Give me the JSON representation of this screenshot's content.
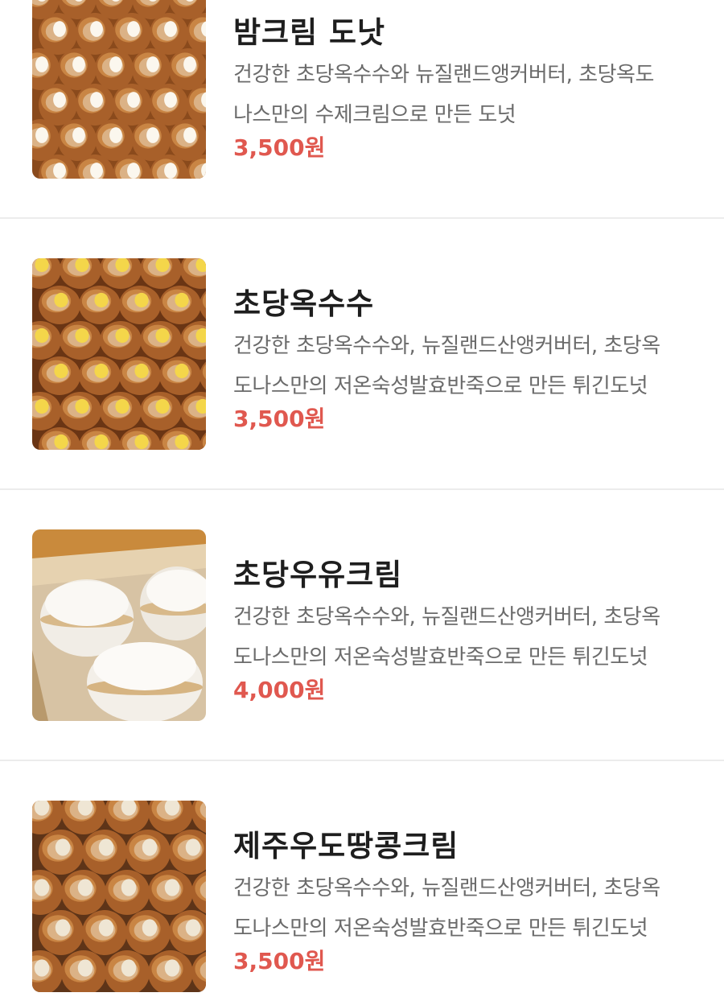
{
  "menu": {
    "items": [
      {
        "name": "밤크림 도낫",
        "description_lines": [
          "건강한 초당옥수수와 뉴질랜드앵커버터, 초당옥도",
          "나스만의 수제크림으로 만든 도넛"
        ],
        "price": "3,500원",
        "image_icon": "cream-donut-photo"
      },
      {
        "name": "초당옥수수",
        "description_lines": [
          "건강한 초당옥수수와, 뉴질랜드산앵커버터, 초당옥",
          "도나스만의 저온숙성발효반죽으로 만든 튀긴도넛"
        ],
        "price": "3,500원",
        "image_icon": "corn-cream-donut-photo"
      },
      {
        "name": "초당우유크림",
        "description_lines": [
          "건강한 초당옥수수와, 뉴질랜드산앵커버터, 초당옥",
          "도나스만의 저온숙성발효반죽으로 만든 튀긴도넛"
        ],
        "price": "4,000원",
        "image_icon": "milk-cream-donut-photo"
      },
      {
        "name": "제주우도땅콩크림",
        "description_lines": [
          "건강한 초당옥수수와, 뉴질랜드산앵커버터, 초당옥",
          "도나스만의 저온숙성발효반죽으로 만든 튀긴도넛"
        ],
        "price": "3,500원",
        "image_icon": "peanut-cream-donut-photo"
      }
    ]
  },
  "colors": {
    "price": "#e0584f",
    "name": "#1e1e1e",
    "description": "#6b6b6b",
    "divider": "#ececec",
    "donut_brown": "#b06a2c",
    "corn_cream": "#f4d64a",
    "milk_cream": "#f7f4ee"
  }
}
